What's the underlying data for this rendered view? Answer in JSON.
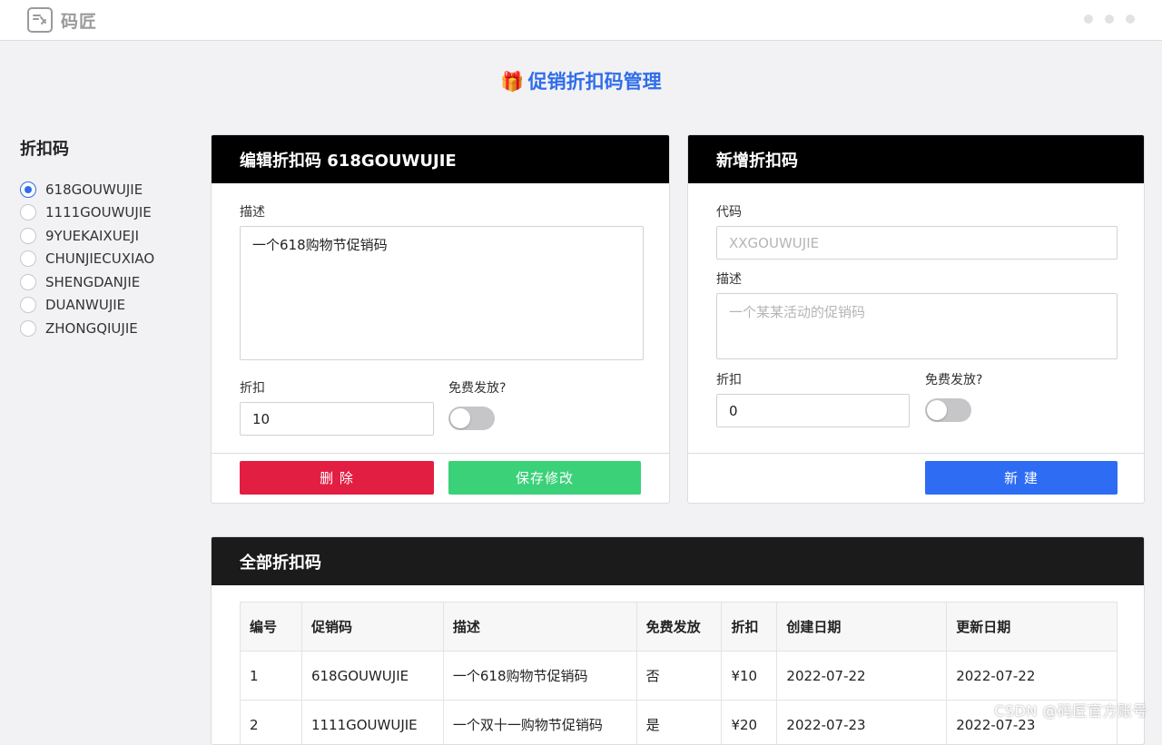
{
  "app": {
    "logo_text": "码匠",
    "page_title": "促销折扣码管理"
  },
  "colors": {
    "accent": "#2f6de9",
    "danger": "#e31e43",
    "success": "#3bd179",
    "primary": "#2e6cf4",
    "header_bg": "#000000"
  },
  "icons": {
    "logo": "logo-icon",
    "title": "gift-icon",
    "window_controls": "window-dots-icon"
  },
  "sidebar": {
    "title": "折扣码",
    "items": [
      {
        "label": "618GOUWUJIE",
        "checked": true
      },
      {
        "label": "1111GOUWUJIE",
        "checked": false
      },
      {
        "label": "9YUEKAIXUEJI",
        "checked": false
      },
      {
        "label": "CHUNJIECUXIAO",
        "checked": false
      },
      {
        "label": "SHENGDANJIE",
        "checked": false
      },
      {
        "label": "DUANWUJIE",
        "checked": false
      },
      {
        "label": "ZHONGQIUJIE",
        "checked": false
      }
    ]
  },
  "edit_panel": {
    "title": "编辑折扣码 618GOUWUJIE",
    "desc_label": "描述",
    "desc_value": "一个618购物节促销码",
    "discount_label": "折扣",
    "discount_value": "10",
    "free_label": "免费发放?",
    "free_on": false,
    "delete_label": "删 除",
    "save_label": "保存修改"
  },
  "new_panel": {
    "title": "新增折扣码",
    "code_label": "代码",
    "code_placeholder": "XXGOUWUJIE",
    "desc_label": "描述",
    "desc_placeholder": "一个某某活动的促销码",
    "discount_label": "折扣",
    "discount_value": "0",
    "free_label": "免费发放?",
    "free_on": false,
    "create_label": "新 建"
  },
  "all_panel": {
    "title": "全部折扣码",
    "columns": [
      "编号",
      "促销码",
      "描述",
      "免费发放",
      "折扣",
      "创建日期",
      "更新日期"
    ],
    "rows": [
      [
        "1",
        "618GOUWUJIE",
        "一个618购物节促销码",
        "否",
        "¥10",
        "2022-07-22",
        "2022-07-22"
      ],
      [
        "2",
        "1111GOUWUJIE",
        "一个双十一购物节促销码",
        "是",
        "¥20",
        "2022-07-23",
        "2022-07-23"
      ]
    ]
  },
  "watermark": "CSDN @码匠官方账号"
}
